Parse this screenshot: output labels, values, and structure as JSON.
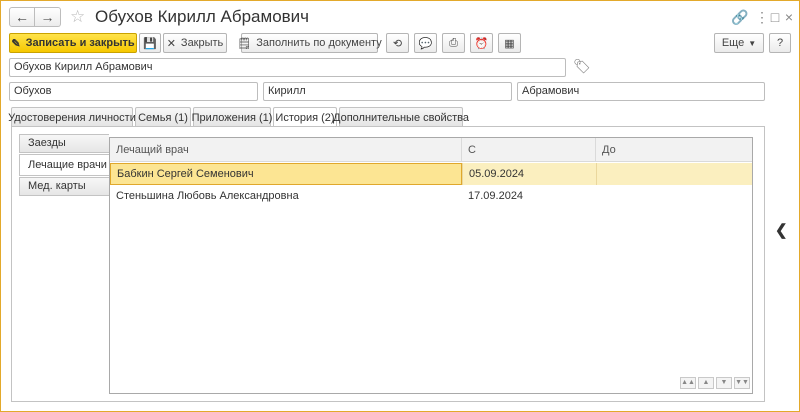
{
  "window": {
    "title": "Обухов Кирилл Абрамович",
    "nav_back_icon": "arrow-left-icon",
    "nav_forward_icon": "arrow-right-icon",
    "favorite_icon": "star-icon",
    "link_icon": "link-icon",
    "more_icon": "more-vertical-icon",
    "maximize_icon": "maximize-icon",
    "close_icon": "close-icon"
  },
  "toolbar": {
    "save_close": "Записать и закрыть",
    "save_icon": "floppy-icon",
    "close": "Закрыть",
    "fill_by_document": "Заполнить по документу",
    "history_icon": "history-icon",
    "comment_icon": "comment-icon",
    "print_icon": "printer-icon",
    "reminder_icon": "alarm-clock-icon",
    "archive_icon": "archive-icon",
    "more": "Еще",
    "help": "?"
  },
  "form": {
    "full_name": "Обухов Кирилл Абрамович",
    "last_name": "Обухов",
    "first_name": "Кирилл",
    "middle_name": "Абрамович"
  },
  "tabs": [
    {
      "label": "Удостоверения личности"
    },
    {
      "label": "Семья (1)"
    },
    {
      "label": "Приложения (1)"
    },
    {
      "label": "История (2)"
    },
    {
      "label": "Дополнительные свойства"
    }
  ],
  "side_tabs": [
    {
      "label": "Заезды"
    },
    {
      "label": "Лечащие врачи"
    },
    {
      "label": "Мед. карты"
    }
  ],
  "table": {
    "columns": [
      "Лечащий врач",
      "С",
      "До"
    ],
    "rows": [
      {
        "doctor": "Бабкин Сергей Семенович",
        "from": "05.09.2024",
        "to": ""
      },
      {
        "doctor": "Стеньшина Любовь Александровна",
        "from": "17.09.2024",
        "to": ""
      }
    ]
  },
  "colors": {
    "accent": "#f6c800",
    "selection": "#fbefbf",
    "frame": "#e3a92b"
  }
}
